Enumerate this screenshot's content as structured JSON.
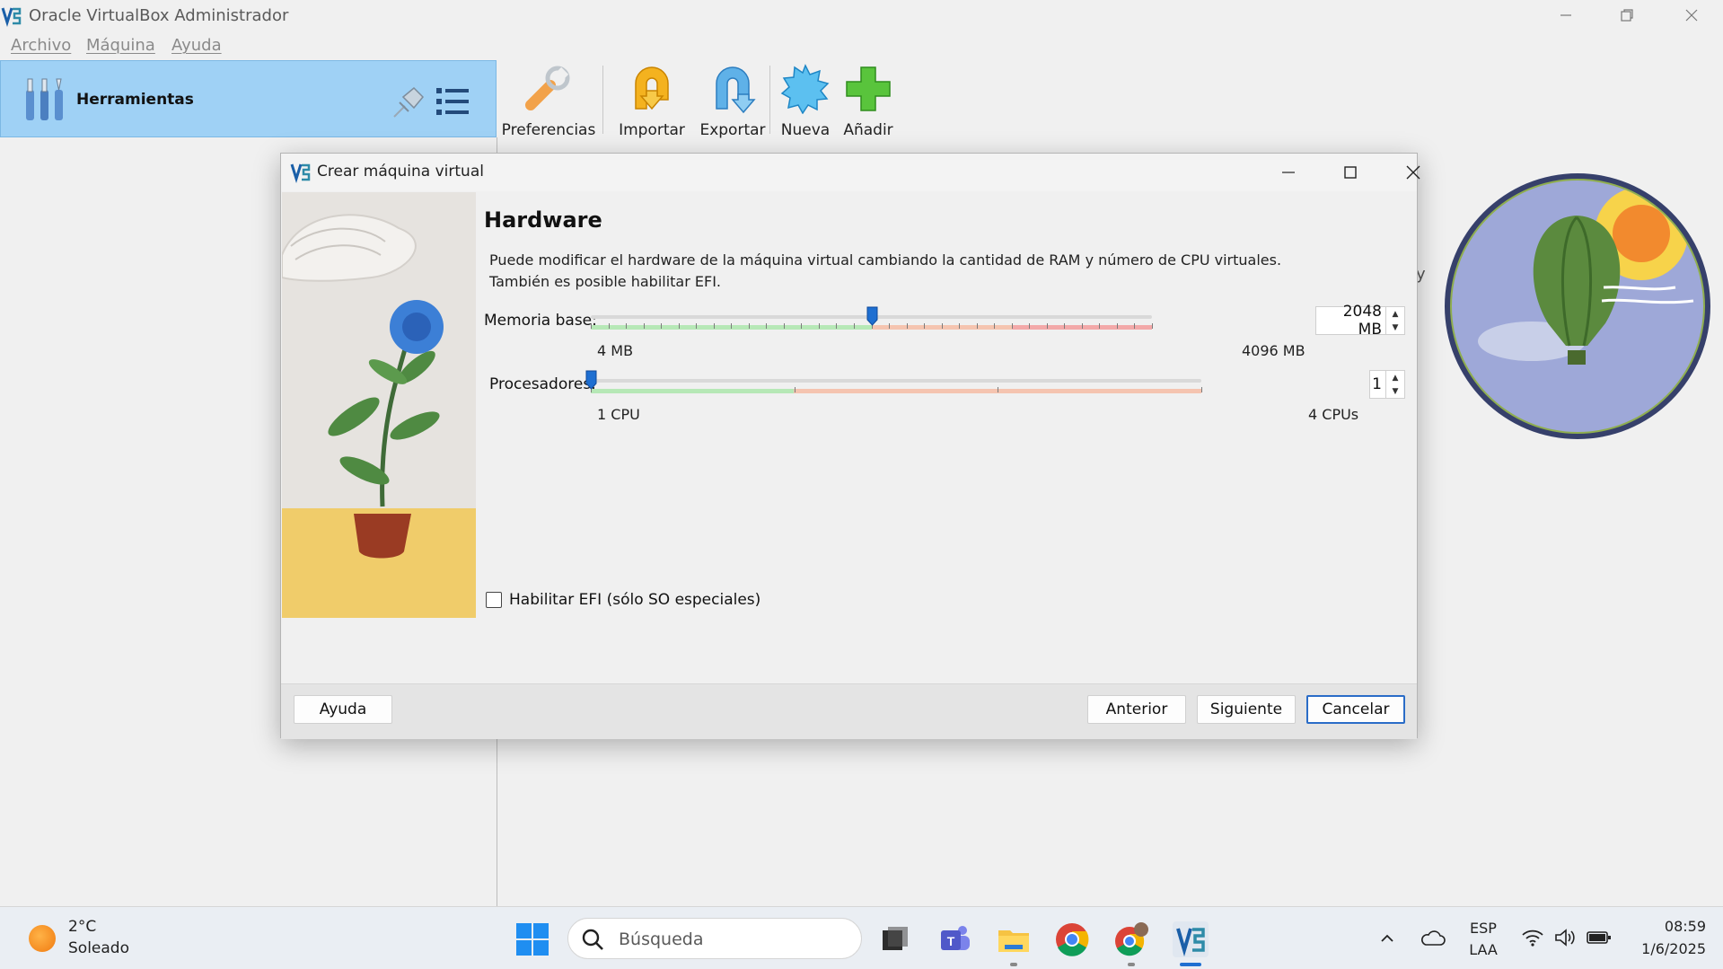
{
  "window": {
    "title": "Oracle VirtualBox Administrador"
  },
  "menu": {
    "items": [
      "Archivo",
      "Máquina",
      "Ayuda"
    ]
  },
  "tools": {
    "label": "Herramientas"
  },
  "toolbar": {
    "buttons": [
      {
        "label": "Preferencias",
        "icon": "wrench-icon"
      },
      {
        "label": "Importar",
        "icon": "import-icon"
      },
      {
        "label": "Exportar",
        "icon": "export-icon"
      },
      {
        "label": "Nueva",
        "icon": "new-vm-icon"
      },
      {
        "label": "Añadir",
        "icon": "add-icon"
      }
    ]
  },
  "background_fragment": "y",
  "dialog": {
    "title": "Crear máquina virtual",
    "heading": "Hardware",
    "description_line1": "Puede modificar el hardware de la máquina virtual cambiando la cantidad de RAM y número de CPU virtuales.",
    "description_line2": "También es posible habilitar EFI.",
    "memory": {
      "label": "Memoria base:",
      "value": "2048 MB",
      "min_label": "4 MB",
      "max_label": "4096 MB",
      "value_fraction": 0.5
    },
    "cpu": {
      "label": "Procesadores:",
      "value": "1",
      "min_label": "1 CPU",
      "max_label": "4 CPUs",
      "value_fraction": 0.0
    },
    "efi": {
      "label": "Habilitar EFI (sólo SO especiales)",
      "checked": false
    },
    "buttons": {
      "help": "Ayuda",
      "back": "Anterior",
      "next": "Siguiente",
      "cancel": "Cancelar"
    }
  },
  "taskbar": {
    "weather_temp": "2°C",
    "weather_desc": "Soleado",
    "search_placeholder": "Búsqueda",
    "lang_line1": "ESP",
    "lang_line2": "LAA",
    "time": "08:59",
    "date": "1/6/2025"
  },
  "colors": {
    "tools_bg": "#9fd1f5",
    "slider_green": "#b6e8b6",
    "slider_orange": "#f5c4b0",
    "slider_red": "#f3a9a9",
    "thumb_blue": "#1e6fd1",
    "default_button_border": "#2a6cc7"
  }
}
